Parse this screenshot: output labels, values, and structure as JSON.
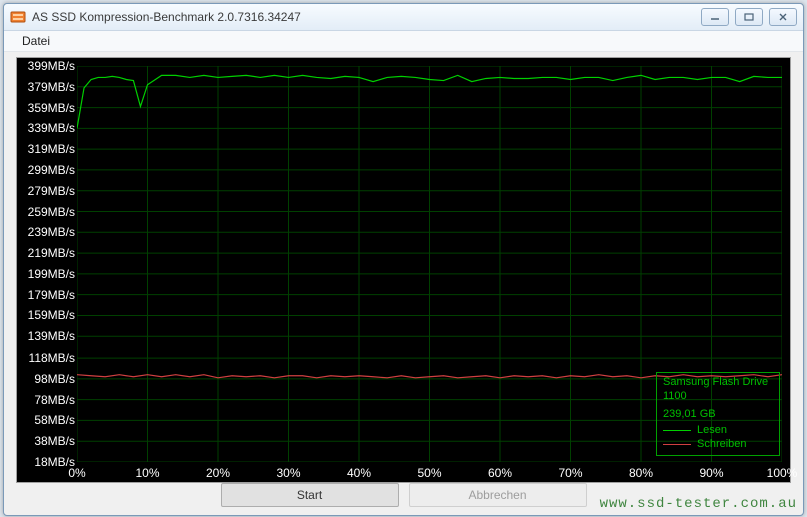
{
  "window": {
    "title": "AS SSD Kompression-Benchmark 2.0.7316.34247"
  },
  "menu": {
    "file": "Datei"
  },
  "buttons": {
    "start": "Start",
    "cancel": "Abbrechen"
  },
  "legend": {
    "device": "Samsung Flash Drive",
    "device2": "1100",
    "capacity": "239,01 GB",
    "read": "Lesen",
    "write": "Schreiben",
    "read_color": "#00d000",
    "write_color": "#d04040"
  },
  "watermark": "www.ssd-tester.com.au",
  "chart_data": {
    "type": "line",
    "xlabel": "",
    "ylabel": "",
    "x_unit": "%",
    "y_unit": "MB/s",
    "xlim": [
      0,
      100
    ],
    "ylim": [
      18,
      399
    ],
    "x_ticks": [
      0,
      10,
      20,
      30,
      40,
      50,
      60,
      70,
      80,
      90,
      100
    ],
    "y_ticks": [
      18,
      38,
      58,
      78,
      98,
      118,
      139,
      159,
      179,
      199,
      219,
      239,
      259,
      279,
      299,
      319,
      339,
      359,
      379,
      399
    ],
    "series": [
      {
        "name": "Lesen",
        "color": "#00d000",
        "x": [
          0,
          1,
          2,
          3,
          4,
          5,
          6,
          7,
          8,
          9,
          10,
          12,
          14,
          16,
          18,
          20,
          22,
          24,
          26,
          28,
          30,
          32,
          34,
          36,
          38,
          40,
          42,
          44,
          46,
          48,
          50,
          52,
          54,
          56,
          58,
          60,
          62,
          64,
          66,
          68,
          70,
          72,
          74,
          76,
          78,
          80,
          82,
          84,
          86,
          88,
          90,
          92,
          94,
          96,
          98,
          100
        ],
        "y": [
          339,
          378,
          386,
          388,
          388,
          389,
          388,
          386,
          385,
          360,
          381,
          390,
          390,
          388,
          390,
          388,
          389,
          390,
          388,
          390,
          388,
          390,
          388,
          387,
          389,
          388,
          384,
          388,
          389,
          388,
          386,
          385,
          390,
          384,
          387,
          388,
          387,
          387,
          388,
          388,
          386,
          388,
          388,
          385,
          388,
          390,
          386,
          388,
          388,
          386,
          388,
          388,
          384,
          389,
          388,
          388
        ]
      },
      {
        "name": "Schreiben",
        "color": "#d04040",
        "x": [
          0,
          2,
          4,
          6,
          8,
          10,
          12,
          14,
          16,
          18,
          20,
          22,
          24,
          26,
          28,
          30,
          32,
          34,
          36,
          38,
          40,
          42,
          44,
          46,
          48,
          50,
          52,
          54,
          56,
          58,
          60,
          62,
          64,
          66,
          68,
          70,
          72,
          74,
          76,
          78,
          80,
          82,
          84,
          86,
          88,
          90,
          92,
          94,
          96,
          98,
          100
        ],
        "y": [
          102,
          101,
          100,
          102,
          100,
          102,
          100,
          102,
          100,
          102,
          99,
          101,
          100,
          101,
          99,
          101,
          101,
          99,
          101,
          100,
          101,
          100,
          99,
          101,
          99,
          100,
          101,
          99,
          100,
          101,
          99,
          101,
          100,
          101,
          99,
          101,
          100,
          102,
          100,
          101,
          99,
          101,
          100,
          102,
          100,
          101,
          100,
          101,
          102,
          100,
          102
        ]
      }
    ]
  }
}
